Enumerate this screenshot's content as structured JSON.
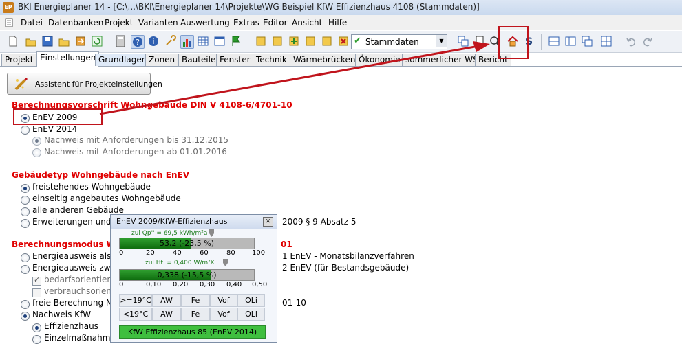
{
  "window": {
    "title": "BKI Energieplaner 14 - [C:\\...\\BKI\\Energieplaner 14\\Projekte\\WG Beispiel KfW Effizienzhaus 4108 (Stammdaten)]",
    "icon_text": "EP"
  },
  "menu": [
    "Datei",
    "Datenbanken",
    "Projekt",
    "Varianten",
    "Auswertung",
    "Extras",
    "Editor",
    "Ansicht",
    "Hilfe"
  ],
  "toolbar": {
    "combo_value": "Stammdaten",
    "accent": "#c0141c"
  },
  "tabs": [
    "Projekt",
    "Einstellungen",
    "Grundlagen",
    "Zonen",
    "Bauteile",
    "Fenster",
    "Technik",
    "Wärmebrücken",
    "Ökonomie",
    "sommerlicher WS",
    "Bericht"
  ],
  "assistant_button": "Assistent für Projekteinstellungen",
  "sections": {
    "berechnungsvorschrift": {
      "title": "Berechnungsvorschrift Wohngebäude DIN V 4108-6/4701-10",
      "options": [
        "EnEV 2009",
        "EnEV 2014"
      ],
      "sub_options": [
        "Nachweis mit Anforderungen bis 31.12.2015",
        "Nachweis mit Anforderungen ab 01.01.2016"
      ]
    },
    "gebaeudetyp": {
      "title": "Gebäudetyp Wohngebäude nach EnEV",
      "options": [
        "freistehendes Wohngebäude",
        "einseitig angebautes Wohngebäude",
        "alle anderen Gebäude",
        "Erweiterungen und A"
      ],
      "erweiterung_tail": "2009 § 9 Absatz 5"
    },
    "berechnungsmodus": {
      "title_left": "Berechnungsmodus Wo",
      "title_right": "01",
      "options": [
        "Energieausweis als ö",
        "Energieausweis zwec",
        "freie Berechnung Mo",
        "Nachweis KfW"
      ],
      "option_tails": [
        "1 EnEV - Monatsbilanzverfahren",
        "2 EnEV (für Bestandsgebäude)",
        "01-10"
      ],
      "checks": [
        "bedarfsorientierte",
        "verbrauchsorienti"
      ],
      "kfw_options": [
        "Effizienzhaus",
        "Einzelmaßnahmen"
      ]
    }
  },
  "popup": {
    "title": "EnEV 2009/KfW-Effizienzhaus",
    "qp_label": "zul Qp'' = 69,5 kWh/m²a",
    "qp_value": "53,2 (-23,5 %)",
    "qp_fraction": 0.532,
    "qp_scale": [
      "0",
      "20",
      "40",
      "60",
      "80",
      "100"
    ],
    "ht_label": "zul Ht' = 0,400 W/m²K",
    "ht_value": "0,338 (-15,5 %)",
    "ht_fraction": 0.676,
    "ht_scale": [
      "0",
      "0,10",
      "0,20",
      "0,30",
      "0,40",
      "0,50"
    ],
    "grid_rows": [
      [
        ">=19°C",
        "AW",
        "Fe",
        "Vof",
        "OLi"
      ],
      [
        "<19°C",
        "AW",
        "Fe",
        "Vof",
        "OLi"
      ]
    ],
    "result": "KfW Effizienzhaus 85 (EnEV 2014)"
  }
}
